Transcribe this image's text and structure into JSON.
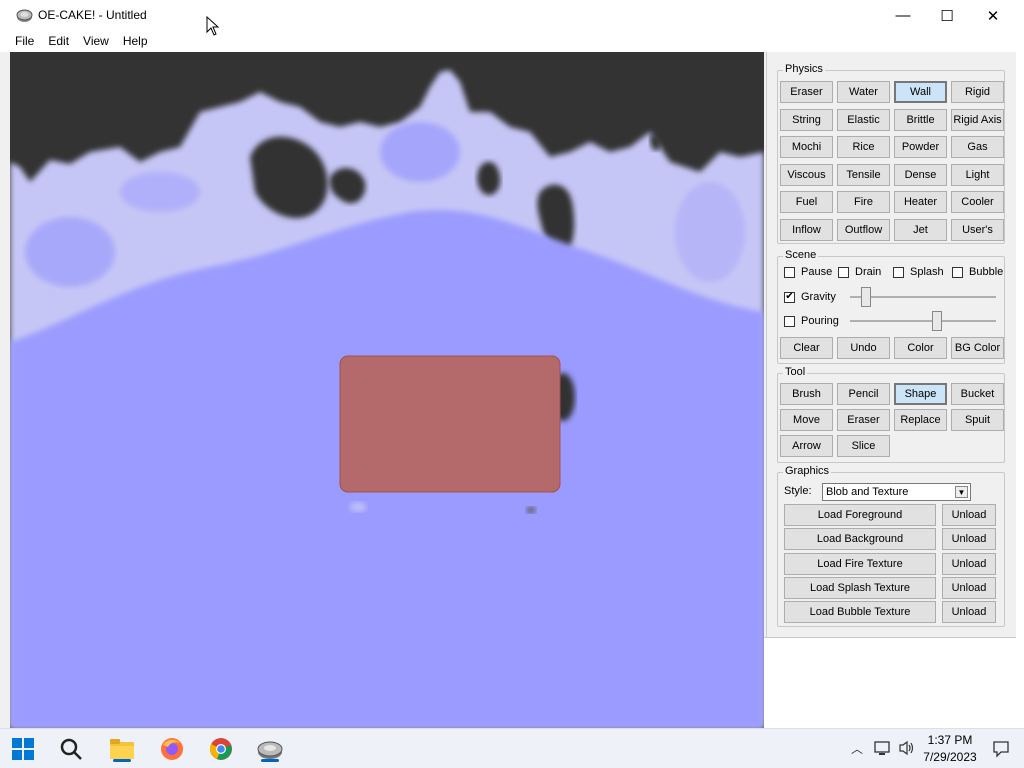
{
  "window": {
    "title": "OE-CAKE! - Untitled",
    "controls": {
      "minimize": "—",
      "maximize": "☐",
      "close": "✕"
    }
  },
  "menu": [
    "File",
    "Edit",
    "View",
    "Help"
  ],
  "panel": {
    "physics": {
      "title": "Physics",
      "buttons": [
        "Eraser",
        "Water",
        "Wall",
        "Rigid",
        "String",
        "Elastic",
        "Brittle",
        "Rigid Axis",
        "Mochi",
        "Rice",
        "Powder",
        "Gas",
        "Viscous",
        "Tensile",
        "Dense",
        "Light",
        "Fuel",
        "Fire",
        "Heater",
        "Cooler",
        "Inflow",
        "Outflow",
        "Jet",
        "User's"
      ],
      "selected": "Wall"
    },
    "scene": {
      "title": "Scene",
      "checks": [
        {
          "label": "Pause",
          "checked": false
        },
        {
          "label": "Drain",
          "checked": false
        },
        {
          "label": "Splash",
          "checked": false
        },
        {
          "label": "Bubble",
          "checked": false
        }
      ],
      "gravity": {
        "label": "Gravity",
        "checked": true,
        "level": 0.08
      },
      "pouring": {
        "label": "Pouring",
        "checked": false,
        "level": 0.6
      },
      "buttons": [
        "Clear",
        "Undo",
        "Color",
        "BG Color"
      ]
    },
    "tool": {
      "title": "Tool",
      "buttons": [
        "Brush",
        "Pencil",
        "Shape",
        "Bucket",
        "Move",
        "Eraser",
        "Replace",
        "Spuit",
        "Arrow",
        "Slice"
      ],
      "selected": "Shape"
    },
    "graphics": {
      "title": "Graphics",
      "style_label": "Style:",
      "style_value": "Blob and Texture",
      "loads": [
        "Load Foreground",
        "Load Background",
        "Load Fire Texture",
        "Load Splash Texture",
        "Load Bubble Texture"
      ],
      "unload": "Unload"
    }
  },
  "colors": {
    "water": "#9b9bff",
    "water_light": "#c4c4f8",
    "background": "#333333",
    "rigid": "#b46a6a",
    "selected_btn": "#cce4f7"
  },
  "taskbar": {
    "icons": [
      "windows-start-icon",
      "search-icon",
      "file-explorer-icon",
      "firefox-icon",
      "chrome-icon",
      "oe-cake-icon"
    ],
    "time": "1:37 PM",
    "date": "7/29/2023"
  }
}
